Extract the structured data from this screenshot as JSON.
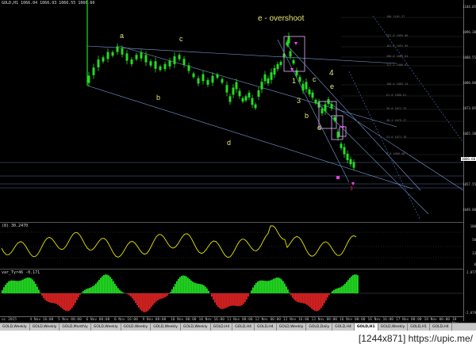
{
  "header": {
    "title": "GOLD,H1  1066.04 1066.93 1066.55 1066.60"
  },
  "annotations": {
    "overshoot": "e - overshoot",
    "wave_a": "a",
    "wave_b": "b",
    "wave_c": "c",
    "wave_d": "d",
    "wave_1": "1",
    "wave_3": "3",
    "wave_4": "4",
    "wave_e": "e",
    "wave_b2": "b",
    "wave_c2": "c",
    "wave_d2": "d",
    "wave_c3": "c",
    "wave_5": "5",
    "wave_3r": "3"
  },
  "price_axis": [
    "1104.05",
    "1096.30",
    "1088.55",
    "1080.80",
    "1073.05",
    "1065.30",
    "1057.55",
    "1049.80"
  ],
  "current_price": "1066.60",
  "fib_levels": [
    "100 1101.27",
    "261.8 1095.06",
    "161.8 1091.96",
    "200.0 1089.04",
    "127.2 1086.97",
    "100.0 1083.24",
    "61.8 1080.61",
    "50.0 1077.75",
    "38.2 1075.27",
    "23.6 1071.76",
    "0.0 1068.48"
  ],
  "ind1": {
    "label": "(8) 30.2470",
    "axis": [
      "100",
      "50",
      "32",
      "0"
    ]
  },
  "ind2": {
    "label": "var_Tyr46 -0.171",
    "axis": [
      "2.077",
      "",
      "",
      "-2.079"
    ]
  },
  "time_axis": [
    "oc 2015",
    "4 Nov 16:00",
    "5 Nov 08:00",
    "6 Nov 00:00",
    "6 Nov 16:00",
    "9 Nov 08:00",
    "10 Nov 00:00",
    "10 Nov 16:00",
    "11 Nov 08:00",
    "12 Nov 00:00",
    "12 Nov 16:00",
    "13 Nov 08:00",
    "16 Nov 00:00",
    "16 Nov 16:00",
    "17 Nov 08:00",
    "18 Nov 00:00",
    "18 Nov 16:00"
  ],
  "tabs": [
    "GOLD,Weekly",
    "GOLD,Weekly",
    "GOLD,Monthly",
    "GOLD,Weekly",
    "GOLD,Weekly",
    "GOLD,Weekly",
    "GOLD,Weekly",
    "GOLD,H4",
    "GOLD,H4",
    "GOLD,H4",
    "GOLD,Weekly",
    "GOLD,Daily",
    "GOLD,H4",
    "GOLD,H1",
    "GOLD,Weekly",
    "GOLD,H1",
    "GOLD,H4"
  ],
  "active_tab": 13,
  "footer": "[1244x871] https://upic.me/",
  "colors": {
    "bull": "#22dd22",
    "bear": "#dd2222",
    "osc": "#e8e800",
    "cand": "#22dd22",
    "line": "#7a9ed8"
  }
}
